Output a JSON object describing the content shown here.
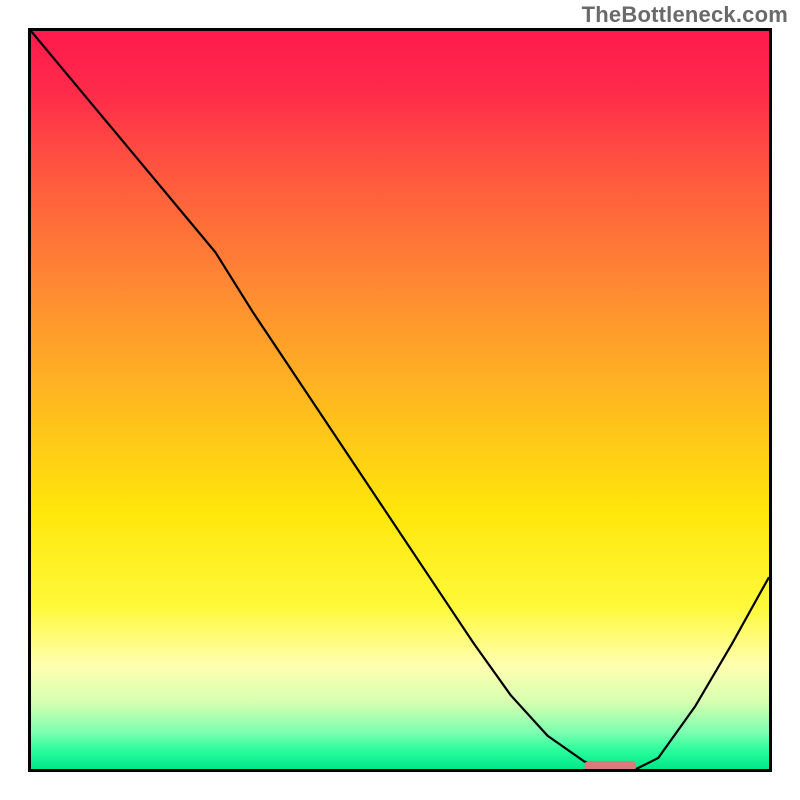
{
  "watermark": "TheBottleneck.com",
  "chart_data": {
    "type": "line",
    "title": "",
    "xlabel": "",
    "ylabel": "",
    "xlim": [
      0,
      100
    ],
    "ylim": [
      0,
      100
    ],
    "series": [
      {
        "name": "curve",
        "x": [
          0,
          5,
          10,
          15,
          20,
          25,
          30,
          35,
          40,
          45,
          50,
          55,
          60,
          65,
          70,
          75,
          79,
          82,
          85,
          90,
          95,
          100
        ],
        "y": [
          100,
          94,
          88,
          82,
          76,
          70,
          62,
          54.5,
          47,
          39.5,
          32,
          24.5,
          17,
          10,
          4.5,
          1.0,
          0.0,
          0.0,
          1.5,
          8.5,
          17,
          26
        ]
      }
    ],
    "marker_segment": {
      "x_start": 75,
      "x_end": 82,
      "y": 0.4
    },
    "background_gradient": {
      "stops": [
        {
          "offset": 0.0,
          "color": "#ff1a4d"
        },
        {
          "offset": 0.08,
          "color": "#ff2a4a"
        },
        {
          "offset": 0.2,
          "color": "#ff5a3e"
        },
        {
          "offset": 0.35,
          "color": "#ff8a32"
        },
        {
          "offset": 0.5,
          "color": "#ffb91f"
        },
        {
          "offset": 0.65,
          "color": "#ffe60a"
        },
        {
          "offset": 0.78,
          "color": "#fff93a"
        },
        {
          "offset": 0.86,
          "color": "#ffffb0"
        },
        {
          "offset": 0.91,
          "color": "#d6ffb0"
        },
        {
          "offset": 0.95,
          "color": "#7dffb0"
        },
        {
          "offset": 0.975,
          "color": "#2afc9c"
        },
        {
          "offset": 1.0,
          "color": "#00e888"
        }
      ]
    },
    "colors": {
      "curve_stroke": "#000000",
      "marker_fill": "#d97a7c",
      "border": "#000000"
    }
  }
}
